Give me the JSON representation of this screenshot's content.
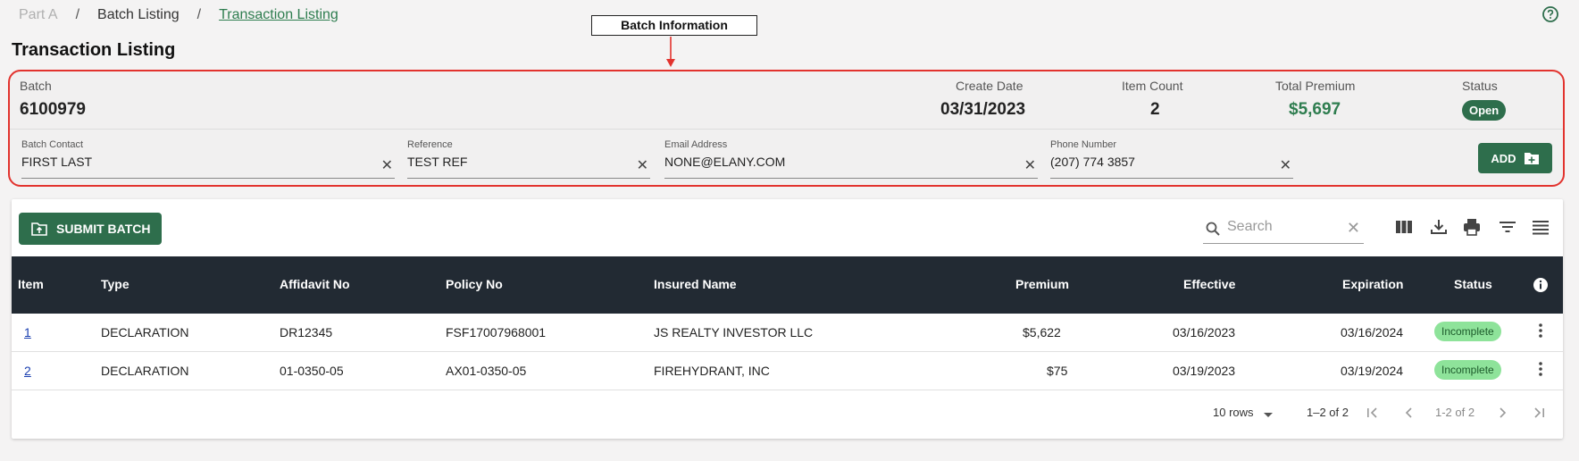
{
  "breadcrumb": {
    "items": [
      {
        "label": "Part A"
      },
      {
        "label": "Batch Listing"
      },
      {
        "label": "Transaction Listing"
      }
    ],
    "separator": "/"
  },
  "page_title": "Transaction Listing",
  "annotation": {
    "label": "Batch Information"
  },
  "batch": {
    "batch_label": "Batch",
    "batch_value": "6100979",
    "create_date_label": "Create Date",
    "create_date_value": "03/31/2023",
    "item_count_label": "Item Count",
    "item_count_value": "2",
    "total_premium_label": "Total Premium",
    "total_premium_value": "$5,697",
    "status_label": "Status",
    "status_value": "Open"
  },
  "fields": {
    "contact": {
      "label": "Batch Contact",
      "value": "FIRST LAST"
    },
    "reference": {
      "label": "Reference",
      "value": "TEST REF"
    },
    "email": {
      "label": "Email Address",
      "value": "NONE@ELANY.COM"
    },
    "phone": {
      "label": "Phone Number",
      "value": "(207) 774 3857"
    }
  },
  "add_button": {
    "label": "ADD"
  },
  "submit_button": {
    "label": "SUBMIT BATCH"
  },
  "search": {
    "placeholder": "Search"
  },
  "table": {
    "columns": [
      "Item",
      "Type",
      "Affidavit No",
      "Policy No",
      "Insured Name",
      "Premium",
      "Effective",
      "Expiration",
      "Status"
    ],
    "rows": [
      {
        "item": "1",
        "type": "DECLARATION",
        "affidavit": "DR12345",
        "policy": "FSF17007968001",
        "insured": "JS REALTY INVESTOR LLC",
        "premium": "$5,622",
        "effective": "03/16/2023",
        "expiration": "03/16/2024",
        "status": "Incomplete"
      },
      {
        "item": "2",
        "type": "DECLARATION",
        "affidavit": "01-0350-05",
        "policy": "AX01-0350-05",
        "insured": "FIREHYDRANT, INC",
        "premium": "$75",
        "effective": "03/19/2023",
        "expiration": "03/19/2024",
        "status": "Incomplete"
      }
    ]
  },
  "pagination": {
    "rows_per_page": "10 rows",
    "range": "1–2 of 2",
    "page_text": "1-2 of 2"
  },
  "colors": {
    "brand_green": "#2e6e4c",
    "link_green": "#2e7d4f",
    "highlight_red": "#e2332e",
    "header_dark": "#222a33",
    "status_incomplete_bg": "#8ee39a"
  },
  "icons": [
    "help-icon",
    "clear-icon",
    "add-folder-icon",
    "upload-folder-icon",
    "search-icon",
    "columns-icon",
    "download-icon",
    "print-icon",
    "filter-icon",
    "density-icon",
    "info-icon",
    "kebab-icon",
    "dropdown-arrow-icon",
    "first-page-icon",
    "prev-page-icon",
    "next-page-icon",
    "last-page-icon"
  ]
}
